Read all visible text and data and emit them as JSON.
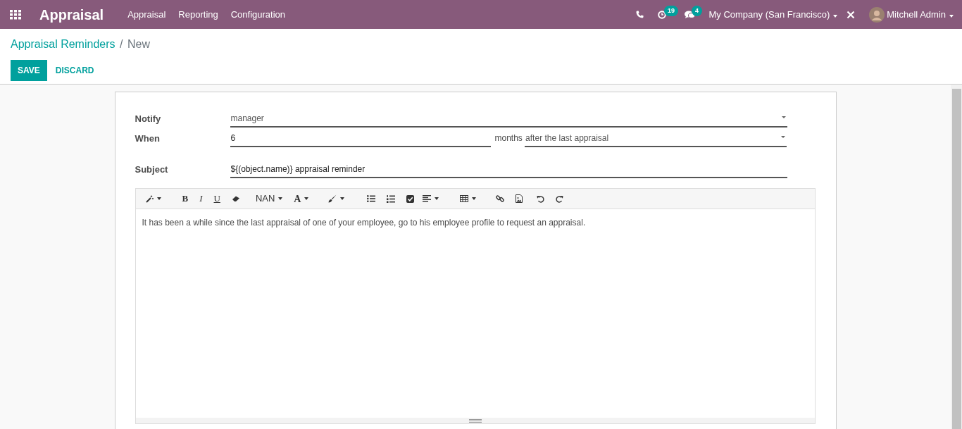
{
  "navbar": {
    "app_title": "Appraisal",
    "menus": [
      "Appraisal",
      "Reporting",
      "Configuration"
    ],
    "activity_count": "19",
    "message_count": "4",
    "company": "My Company (San Francisco)",
    "user": "Mitchell Admin"
  },
  "breadcrumb": {
    "parent": "Appraisal Reminders",
    "separator": "/",
    "current": "New"
  },
  "buttons": {
    "save": "SAVE",
    "discard": "DISCARD"
  },
  "form": {
    "notify_label": "Notify",
    "notify_value": "manager",
    "when_label": "When",
    "when_value": "6",
    "unit": "months",
    "event_value": "after the last appraisal",
    "subject_label": "Subject",
    "subject_value": "${(object.name)} appraisal reminder"
  },
  "editor": {
    "toolbar_labels": [
      "B",
      "I",
      "U",
      "NAN",
      "A"
    ],
    "body": "It has been a while since the last appraisal of one of your employee, go to his employee profile to request an appraisal."
  }
}
